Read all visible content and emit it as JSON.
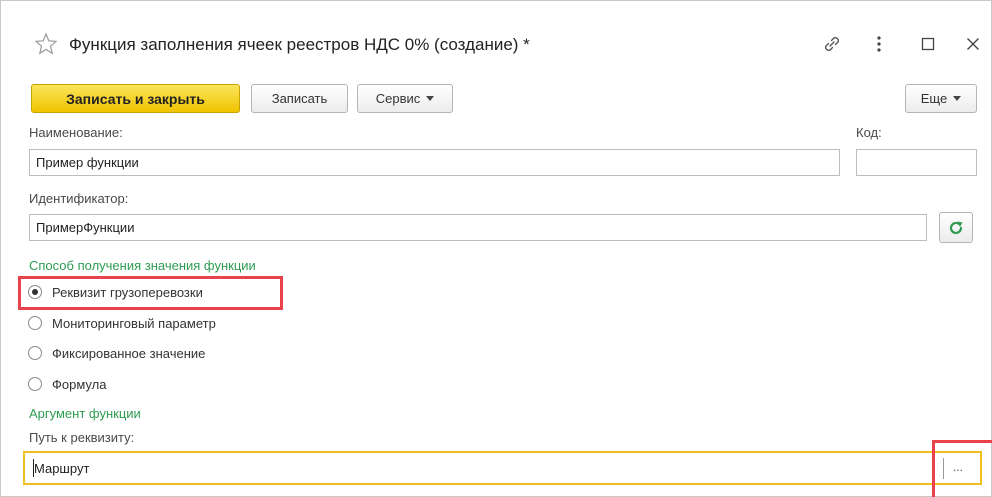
{
  "window": {
    "title": "Функция заполнения ячеек реестров НДС 0% (создание) *"
  },
  "toolbar": {
    "save_close_label": "Записать и закрыть",
    "save_label": "Записать",
    "service_label": "Сервис",
    "more_label": "Еще"
  },
  "fields": {
    "name_label": "Наименование:",
    "name_value": "Пример функции",
    "code_label": "Код:",
    "code_value": "",
    "ident_label": "Идентификатор:",
    "ident_value": "ПримерФункции"
  },
  "method_group": {
    "title": "Способ получения значения функции",
    "options": [
      {
        "label": "Реквизит грузоперевозки",
        "checked": true
      },
      {
        "label": "Мониторинговый параметр",
        "checked": false
      },
      {
        "label": "Фиксированное значение",
        "checked": false
      },
      {
        "label": "Формула",
        "checked": false
      }
    ]
  },
  "argument_group": {
    "title": "Аргумент функции",
    "path_label": "Путь к реквизиту:",
    "path_value": "Маршрут",
    "select_button": "..."
  },
  "icons": {
    "favorite": "star-outline-icon",
    "link": "link-icon",
    "more": "vertical-dots-icon",
    "maximize": "maximize-icon",
    "close": "close-icon",
    "refresh": "refresh-icon"
  },
  "colors": {
    "primary_button": "#f5d023",
    "group_title": "#2e9c52",
    "highlight_red": "#e8434c",
    "highlight_yellow": "#f2c01e",
    "refresh_icon": "#2e9c52"
  }
}
